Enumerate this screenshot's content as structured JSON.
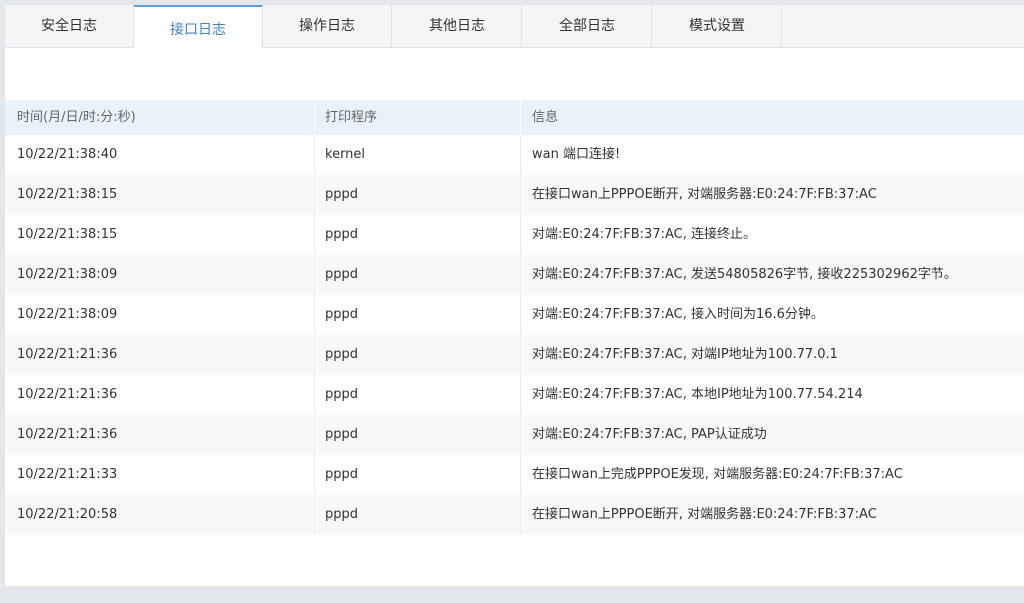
{
  "tabs": [
    {
      "label": "安全日志",
      "active": false
    },
    {
      "label": "接口日志",
      "active": true
    },
    {
      "label": "操作日志",
      "active": false
    },
    {
      "label": "其他日志",
      "active": false
    },
    {
      "label": "全部日志",
      "active": false
    },
    {
      "label": "模式设置",
      "active": false
    }
  ],
  "table": {
    "columns": [
      "时间(月/日/时:分:秒)",
      "打印程序",
      "信息"
    ],
    "rows": [
      [
        "10/22/21:38:40",
        "kernel",
        "wan 端口连接!"
      ],
      [
        "10/22/21:38:15",
        "pppd",
        "在接口wan上PPPOE断开, 对端服务器:E0:24:7F:FB:37:AC"
      ],
      [
        "10/22/21:38:15",
        "pppd",
        "对端:E0:24:7F:FB:37:AC, 连接终止。"
      ],
      [
        "10/22/21:38:09",
        "pppd",
        "对端:E0:24:7F:FB:37:AC, 发送54805826字节, 接收225302962字节。"
      ],
      [
        "10/22/21:38:09",
        "pppd",
        "对端:E0:24:7F:FB:37:AC, 接入时间为16.6分钟。"
      ],
      [
        "10/22/21:21:36",
        "pppd",
        "对端:E0:24:7F:FB:37:AC, 对端IP地址为100.77.0.1"
      ],
      [
        "10/22/21:21:36",
        "pppd",
        "对端:E0:24:7F:FB:37:AC, 本地IP地址为100.77.54.214"
      ],
      [
        "10/22/21:21:36",
        "pppd",
        "对端:E0:24:7F:FB:37:AC, PAP认证成功"
      ],
      [
        "10/22/21:21:33",
        "pppd",
        "在接口wan上完成PPPOE发现, 对端服务器:E0:24:7F:FB:37:AC"
      ],
      [
        "10/22/21:20:58",
        "pppd",
        "在接口wan上PPPOE断开, 对端服务器:E0:24:7F:FB:37:AC"
      ]
    ]
  },
  "colors": {
    "accent": "#3f83c8",
    "header_bg": "#e7f2fb",
    "alt_row_bg": "#f7f8fa"
  }
}
